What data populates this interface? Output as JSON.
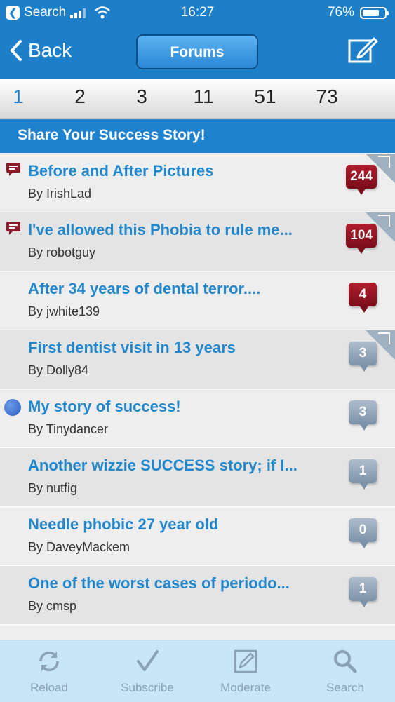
{
  "statusbar": {
    "back_app": "Search",
    "time": "16:27",
    "battery": "76%",
    "battery_fraction": 0.76
  },
  "navbar": {
    "back_label": "Back",
    "title": "Forums"
  },
  "pager": {
    "pages": [
      "1",
      "2",
      "3",
      "11",
      "51",
      "73"
    ],
    "active_page": "1"
  },
  "section": {
    "title": "Share Your Success Story!"
  },
  "threads": [
    {
      "title": "Before and After Pictures",
      "author": "By IrishLad",
      "count": "244",
      "badge": "red",
      "icon": "message-icon",
      "corner": true
    },
    {
      "title": "I've allowed this Phobia to rule me...",
      "author": "By robotguy",
      "count": "104",
      "badge": "red",
      "icon": "message-icon",
      "corner": true
    },
    {
      "title": "After 34 years of dental terror....",
      "author": "By jwhite139",
      "count": "4",
      "badge": "red",
      "icon": "",
      "corner": false
    },
    {
      "title": "First dentist visit in 13 years",
      "author": "By Dolly84",
      "count": "3",
      "badge": "gray",
      "icon": "",
      "corner": true
    },
    {
      "title": "My story of success!",
      "author": "By Tinydancer",
      "count": "3",
      "badge": "gray",
      "icon": "unread-dot-icon",
      "corner": false
    },
    {
      "title": "Another wizzie SUCCESS story; if I...",
      "author": "By nutfig",
      "count": "1",
      "badge": "gray",
      "icon": "",
      "corner": false
    },
    {
      "title": "Needle phobic 27 year old",
      "author": "By DaveyMackem",
      "count": "0",
      "badge": "gray",
      "icon": "",
      "corner": false
    },
    {
      "title": "One of the worst cases of periodo...",
      "author": "By cmsp",
      "count": "1",
      "badge": "gray",
      "icon": "",
      "corner": false
    }
  ],
  "tabbar": {
    "reload": "Reload",
    "subscribe": "Subscribe",
    "moderate": "Moderate",
    "search": "Search"
  },
  "colors": {
    "accent": "#1e7fc9",
    "title_link": "#2387cc",
    "badge_red": "#9a1424",
    "badge_gray": "#8fa3b8",
    "tabbar_bg": "#c9e6f8"
  }
}
